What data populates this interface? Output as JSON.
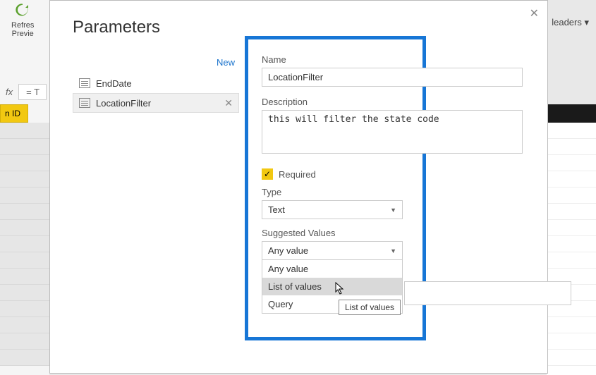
{
  "background": {
    "refresh_label": "Refres",
    "preview_label": "Previe",
    "headers_trunc": "leaders ▾",
    "fx_label": "fx",
    "formula_prefix": "= T",
    "col_header": "n ID"
  },
  "dialog": {
    "title": "Parameters",
    "close": "✕",
    "new_link": "New",
    "items": [
      {
        "label": "EndDate",
        "selected": false
      },
      {
        "label": "LocationFilter",
        "selected": true
      }
    ],
    "delete_glyph": "✕"
  },
  "form": {
    "name_label": "Name",
    "name_value": "LocationFilter",
    "desc_label": "Description",
    "desc_value": "this will filter the state code",
    "required_label": "Required",
    "required_check": "✓",
    "type_label": "Type",
    "type_value": "Text",
    "sv_label": "Suggested Values",
    "sv_value": "Any value",
    "sv_options": [
      "Any value",
      "List of values",
      "Query"
    ],
    "hover_option": "List of values",
    "tooltip": "List of values"
  }
}
